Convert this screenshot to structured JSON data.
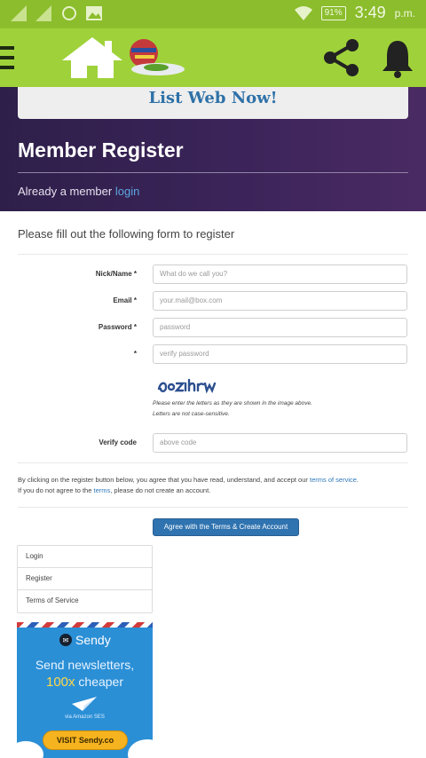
{
  "status_bar": {
    "battery": "91%",
    "time": "3:49",
    "ampm": "p.m."
  },
  "app_bar": {
    "icons": [
      "menu-icon",
      "home-icon",
      "globe-logo-icon",
      "share-icon",
      "bell-icon"
    ],
    "accent": "#9fd23a"
  },
  "hero": {
    "banner": "List Web Now!",
    "title": "Member Register",
    "member_text": "Already a member",
    "login_link": "login"
  },
  "form": {
    "intro": "Please fill out the following form to register",
    "nick_label": "Nick/Name *",
    "nick_placeholder": "What do we call you?",
    "email_label": "Email *",
    "email_placeholder": "your.mail@box.com",
    "password_label": "Password *",
    "password_placeholder": "password",
    "verify_password_label": "*",
    "verify_password_placeholder": "verify password",
    "captcha_note_1": "Please enter the letters as they are shown in the image above.",
    "captcha_note_2": "Letters are not case-sensitive.",
    "verify_code_label": "Verify code",
    "verify_code_placeholder": "above code",
    "terms_before": "By clicking on the register button below, you agree that you have read, understand, and accept our",
    "terms_link_1": "terms of service",
    "terms_after_1": ".",
    "terms_line2_before": "If you do not agree to the",
    "terms_link_2": "terms",
    "terms_line2_after": ", please do not create an account.",
    "submit_label": "Agree with the Terms & Create Account"
  },
  "side_menu": {
    "items": [
      "Login",
      "Register",
      "Terms of Service"
    ]
  },
  "ad": {
    "brand": "Sendy",
    "line1": "Send newsletters,",
    "line2_big": "100x",
    "line2_rest": "cheaper",
    "via": "via Amazon SES",
    "cta": "VISIT Sendy.co"
  }
}
